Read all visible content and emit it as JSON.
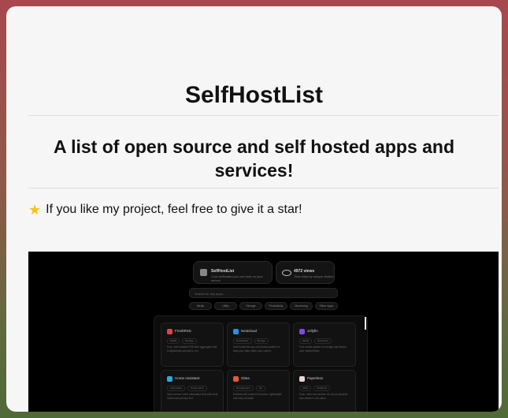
{
  "header": {
    "title": "SelfHostList"
  },
  "tagline": "A list of open source and self hosted apps and services!",
  "star_note": {
    "text": "If you like my project, feel free to give it a star!",
    "icon": "star-icon",
    "icon_color": "#f5c518"
  },
  "preview": {
    "site_card": {
      "title": "SelfHostList",
      "subtitle": "Cool selfhosted you can host on your server!"
    },
    "views_card": {
      "title": "4972 views",
      "subtitle": "Total visits by unique visitors"
    },
    "search_placeholder": "Search for any apps...",
    "filters": [
      "Media",
      "Utility",
      "Storage",
      "Productivity",
      "Monitoring",
      "Other Apps"
    ],
    "apps": [
      {
        "name": "FreshRSS",
        "tags": [
          "Media",
          "Storage"
        ],
        "desc": "Free, self-hostable RSS feed aggregator that is lightweight and fast to run.",
        "color": "#e0424a"
      },
      {
        "name": "Nextcloud",
        "tags": [
          "Productivity",
          "Storage"
        ],
        "desc": "Self-hosted file sync and share platform to keep your data under your control.",
        "color": "#2a8fe8"
      },
      {
        "name": "Jellyfin",
        "tags": [
          "Media",
          "Streaming"
        ],
        "desc": "Free media system to manage and stream your media library.",
        "color": "#7b4bdc"
      },
      {
        "name": "Home Assistant",
        "tags": [
          "Automation",
          "Smart home"
        ],
        "desc": "Open source home automation that puts local control and privacy first.",
        "color": "#2fa8e0"
      },
      {
        "name": "Gitea",
        "tags": [
          "Development",
          "Git"
        ],
        "desc": "Painless self-hosted Git service, lightweight and easy to install.",
        "color": "#e15a32"
      },
      {
        "name": "Paperless",
        "tags": [
          "Utility",
          "Archiving"
        ],
        "desc": "Scan, index and archive all of your physical documents in one place.",
        "color": "#e8d6d6"
      }
    ]
  }
}
